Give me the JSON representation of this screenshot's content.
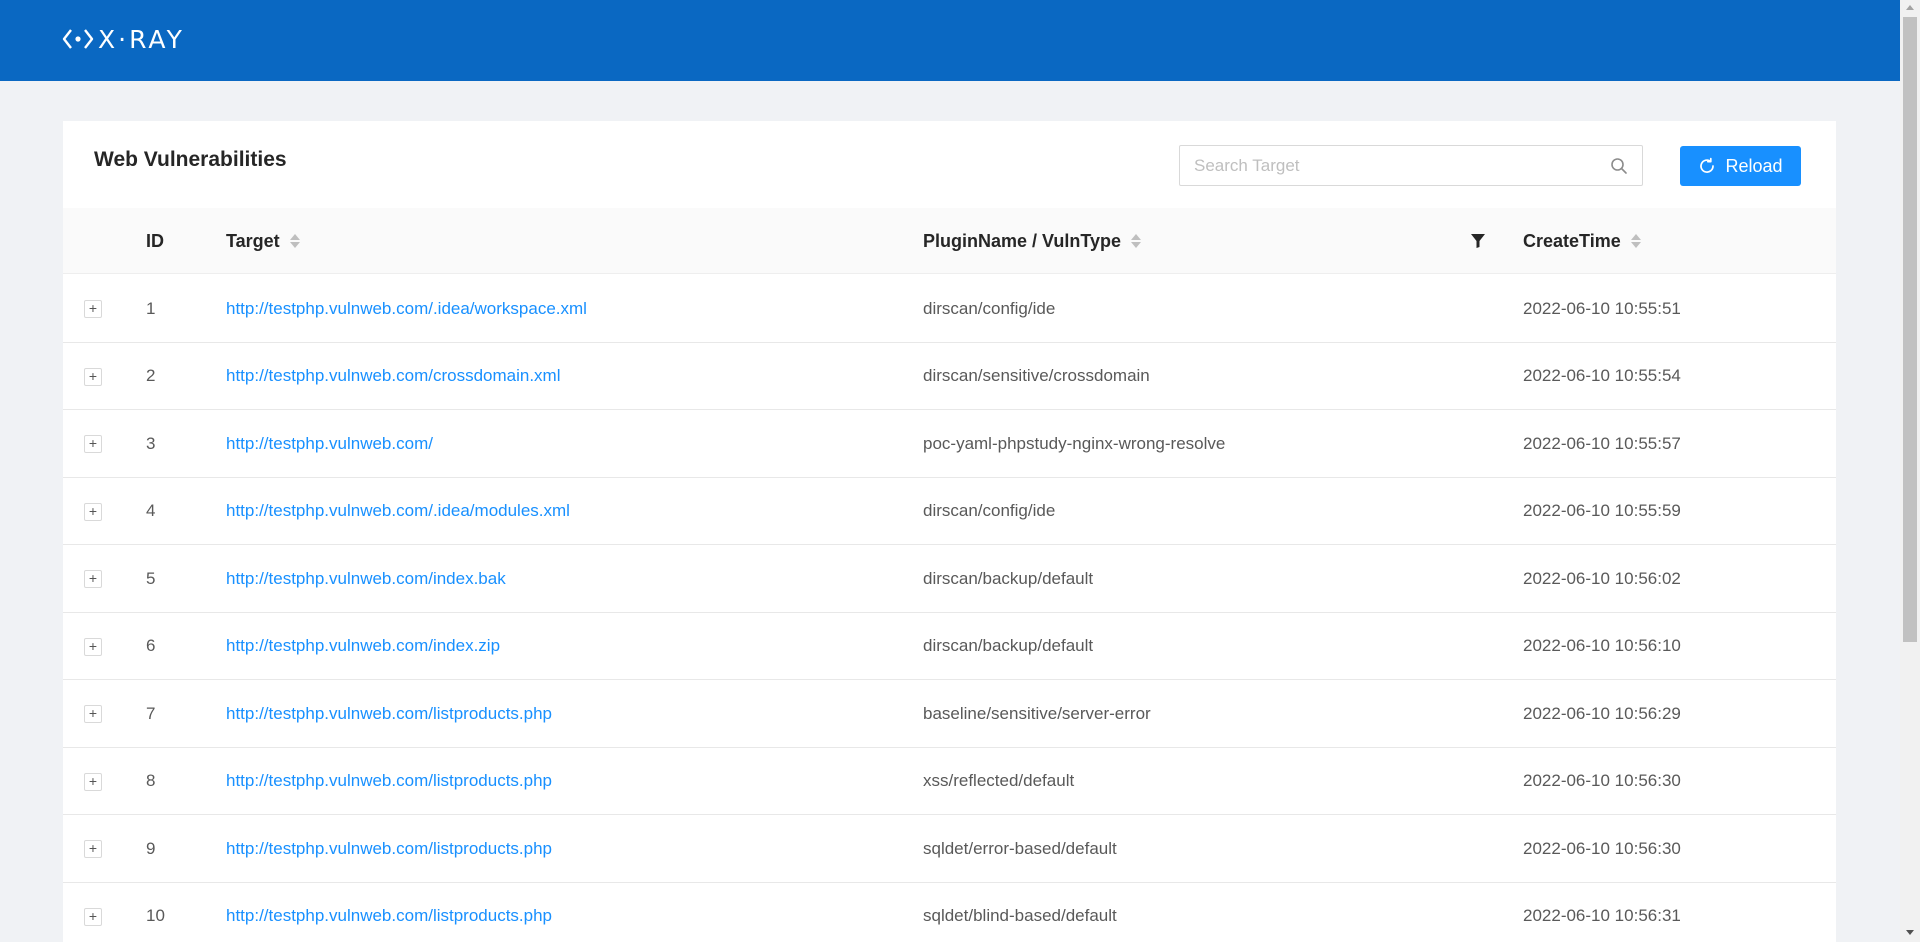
{
  "app": {
    "logo_text": "X·RAY",
    "logo_icon": "diamond-code-icon"
  },
  "page": {
    "title": "Web Vulnerabilities"
  },
  "search": {
    "placeholder": "Search Target",
    "icon": "search-icon"
  },
  "reload": {
    "label": "Reload",
    "icon": "reload-icon"
  },
  "colors": {
    "header_bg": "#0a68c2",
    "primary": "#1890ff",
    "link": "#1890ff",
    "page_bg": "#f0f2f5"
  },
  "table": {
    "columns": {
      "id": "ID",
      "target": "Target",
      "plugin": "PluginName / VulnType",
      "create_time": "CreateTime"
    },
    "rows": [
      {
        "id": "1",
        "target": "http://testphp.vulnweb.com/.idea/workspace.xml",
        "plugin": "dirscan/config/ide",
        "create_time": "2022-06-10 10:55:51"
      },
      {
        "id": "2",
        "target": "http://testphp.vulnweb.com/crossdomain.xml",
        "plugin": "dirscan/sensitive/crossdomain",
        "create_time": "2022-06-10 10:55:54"
      },
      {
        "id": "3",
        "target": "http://testphp.vulnweb.com/",
        "plugin": "poc-yaml-phpstudy-nginx-wrong-resolve",
        "create_time": "2022-06-10 10:55:57"
      },
      {
        "id": "4",
        "target": "http://testphp.vulnweb.com/.idea/modules.xml",
        "plugin": "dirscan/config/ide",
        "create_time": "2022-06-10 10:55:59"
      },
      {
        "id": "5",
        "target": "http://testphp.vulnweb.com/index.bak",
        "plugin": "dirscan/backup/default",
        "create_time": "2022-06-10 10:56:02"
      },
      {
        "id": "6",
        "target": "http://testphp.vulnweb.com/index.zip",
        "plugin": "dirscan/backup/default",
        "create_time": "2022-06-10 10:56:10"
      },
      {
        "id": "7",
        "target": "http://testphp.vulnweb.com/listproducts.php",
        "plugin": "baseline/sensitive/server-error",
        "create_time": "2022-06-10 10:56:29"
      },
      {
        "id": "8",
        "target": "http://testphp.vulnweb.com/listproducts.php",
        "plugin": "xss/reflected/default",
        "create_time": "2022-06-10 10:56:30"
      },
      {
        "id": "9",
        "target": "http://testphp.vulnweb.com/listproducts.php",
        "plugin": "sqldet/error-based/default",
        "create_time": "2022-06-10 10:56:30"
      },
      {
        "id": "10",
        "target": "http://testphp.vulnweb.com/listproducts.php",
        "plugin": "sqldet/blind-based/default",
        "create_time": "2022-06-10 10:56:31"
      }
    ]
  }
}
